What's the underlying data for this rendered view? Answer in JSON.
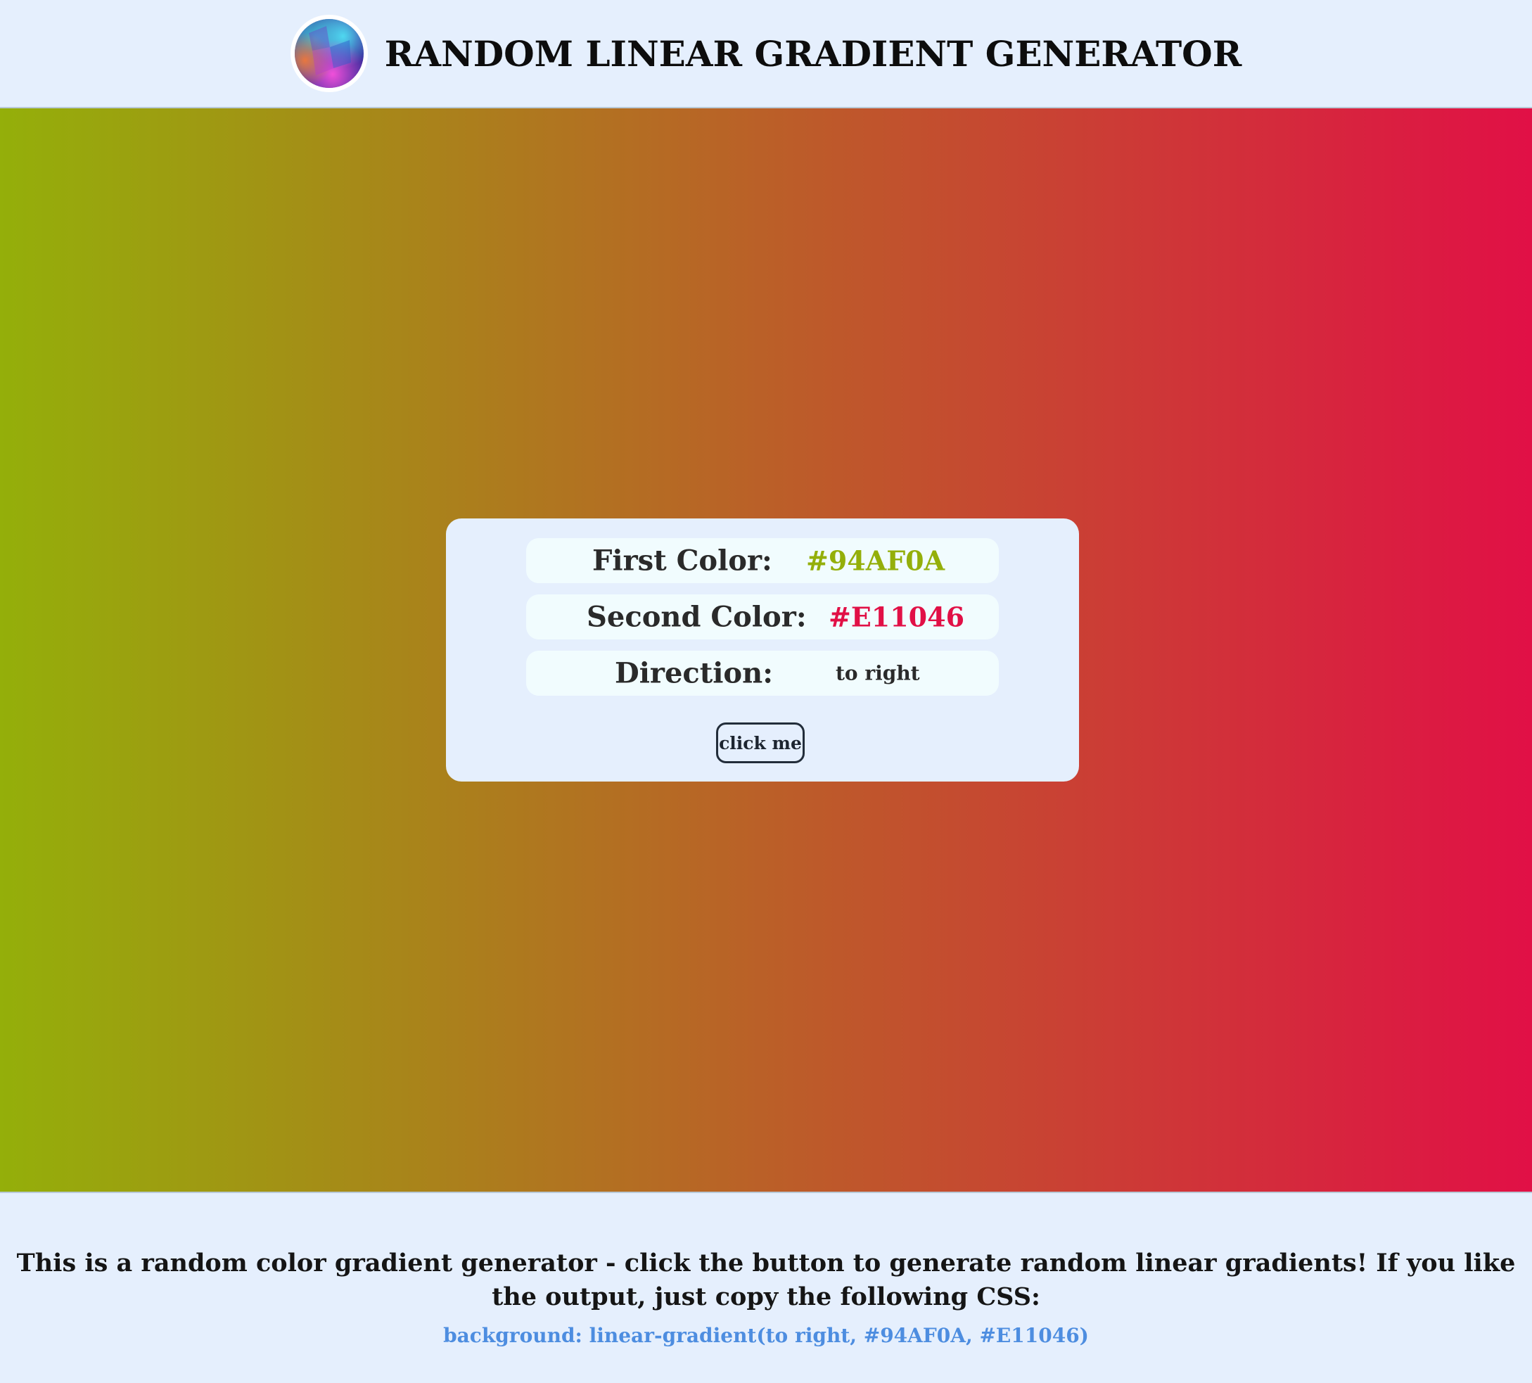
{
  "header": {
    "title": "RANDOM LINEAR GRADIENT GENERATOR"
  },
  "generator": {
    "first_color_label": "First Color:",
    "first_color_value": "#94AF0A",
    "second_color_label": "Second Color:",
    "second_color_value": "#E11046",
    "direction_label": "Direction:",
    "direction_value": "to right",
    "button_label": "click me"
  },
  "footer": {
    "description": "This is a random color gradient generator - click the button to generate random linear gradients! If you like the output, just copy the following CSS:",
    "css_output": "background: linear-gradient(to right, #94AF0A, #E11046)"
  },
  "colors": {
    "first": "#94AF0A",
    "second": "#E11046",
    "page_background": "#E5EFFD",
    "css_text": "#4D8DE0"
  },
  "icons": {
    "logo": "gradient-orb-logo"
  }
}
